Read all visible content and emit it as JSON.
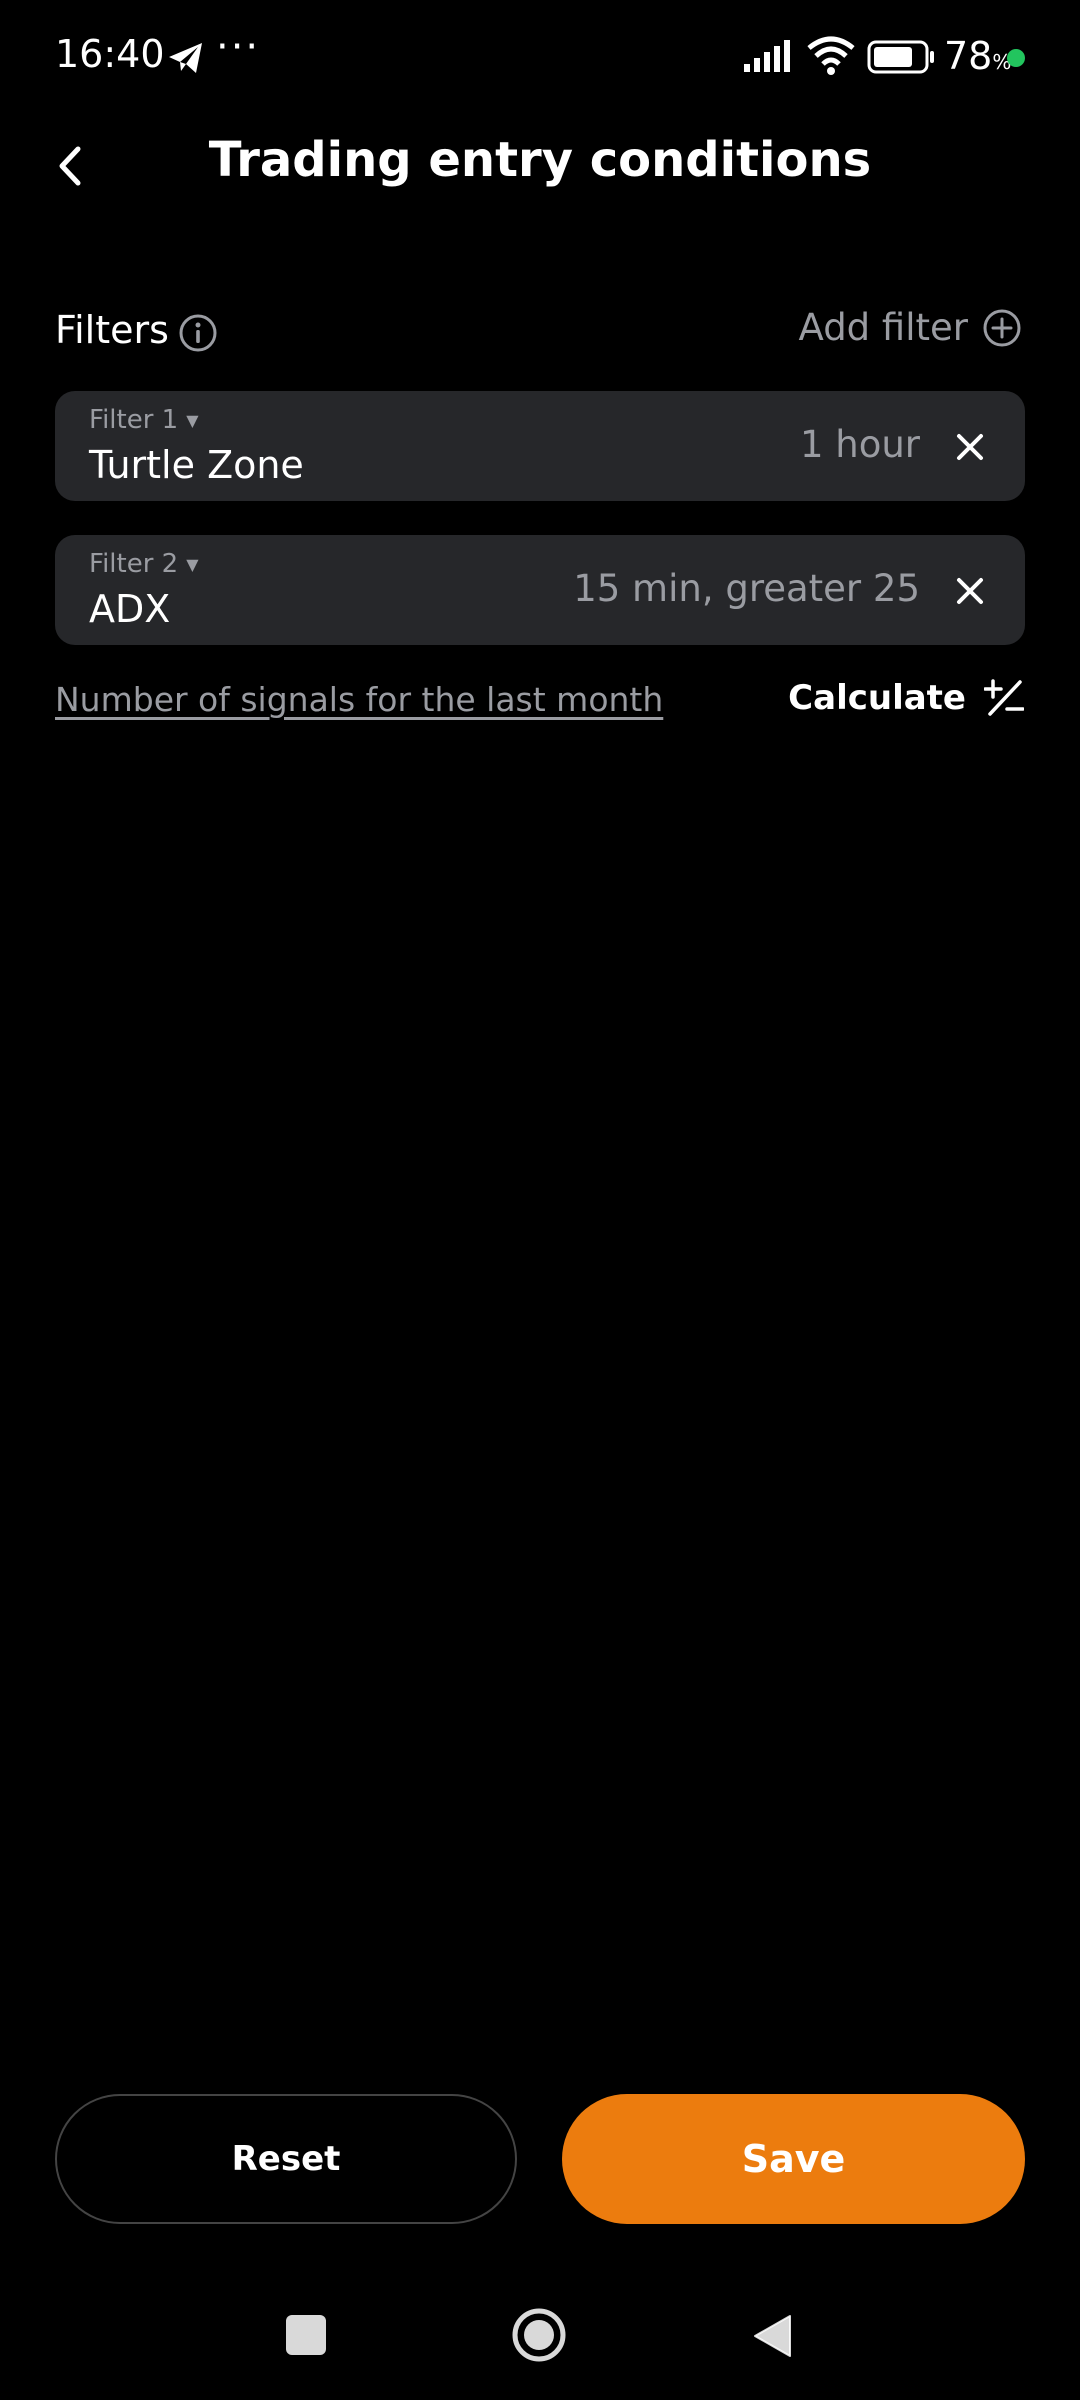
{
  "status_bar": {
    "time": "16:40",
    "more": "···",
    "battery": "78",
    "battery_unit": "%",
    "icons": [
      "telegram-icon",
      "signal-icon",
      "wifi-icon",
      "battery-icon"
    ],
    "charge_color": "#22c55e"
  },
  "header": {
    "title": "Trading entry conditions",
    "back_icon": "chevron-left-icon"
  },
  "filters": {
    "label": "Filters",
    "info_icon": "info-icon",
    "add_label": "Add filter",
    "add_icon": "plus-circle-icon",
    "items": [
      {
        "label": "Filter 1",
        "name": "Turtle Zone",
        "setting": "1 hour"
      },
      {
        "label": "Filter 2",
        "name": "ADX",
        "setting": "15 min, greater 25"
      }
    ]
  },
  "signals": {
    "link": "Number of signals for the last month",
    "calculate_label": "Calculate",
    "calculate_icon": "plus-minus-icon"
  },
  "actions": {
    "reset": "Reset",
    "save": "Save",
    "save_color": "#ec7c0e"
  },
  "nav": {
    "icons": [
      "recents-square-icon",
      "home-circle-icon",
      "back-triangle-icon"
    ]
  }
}
